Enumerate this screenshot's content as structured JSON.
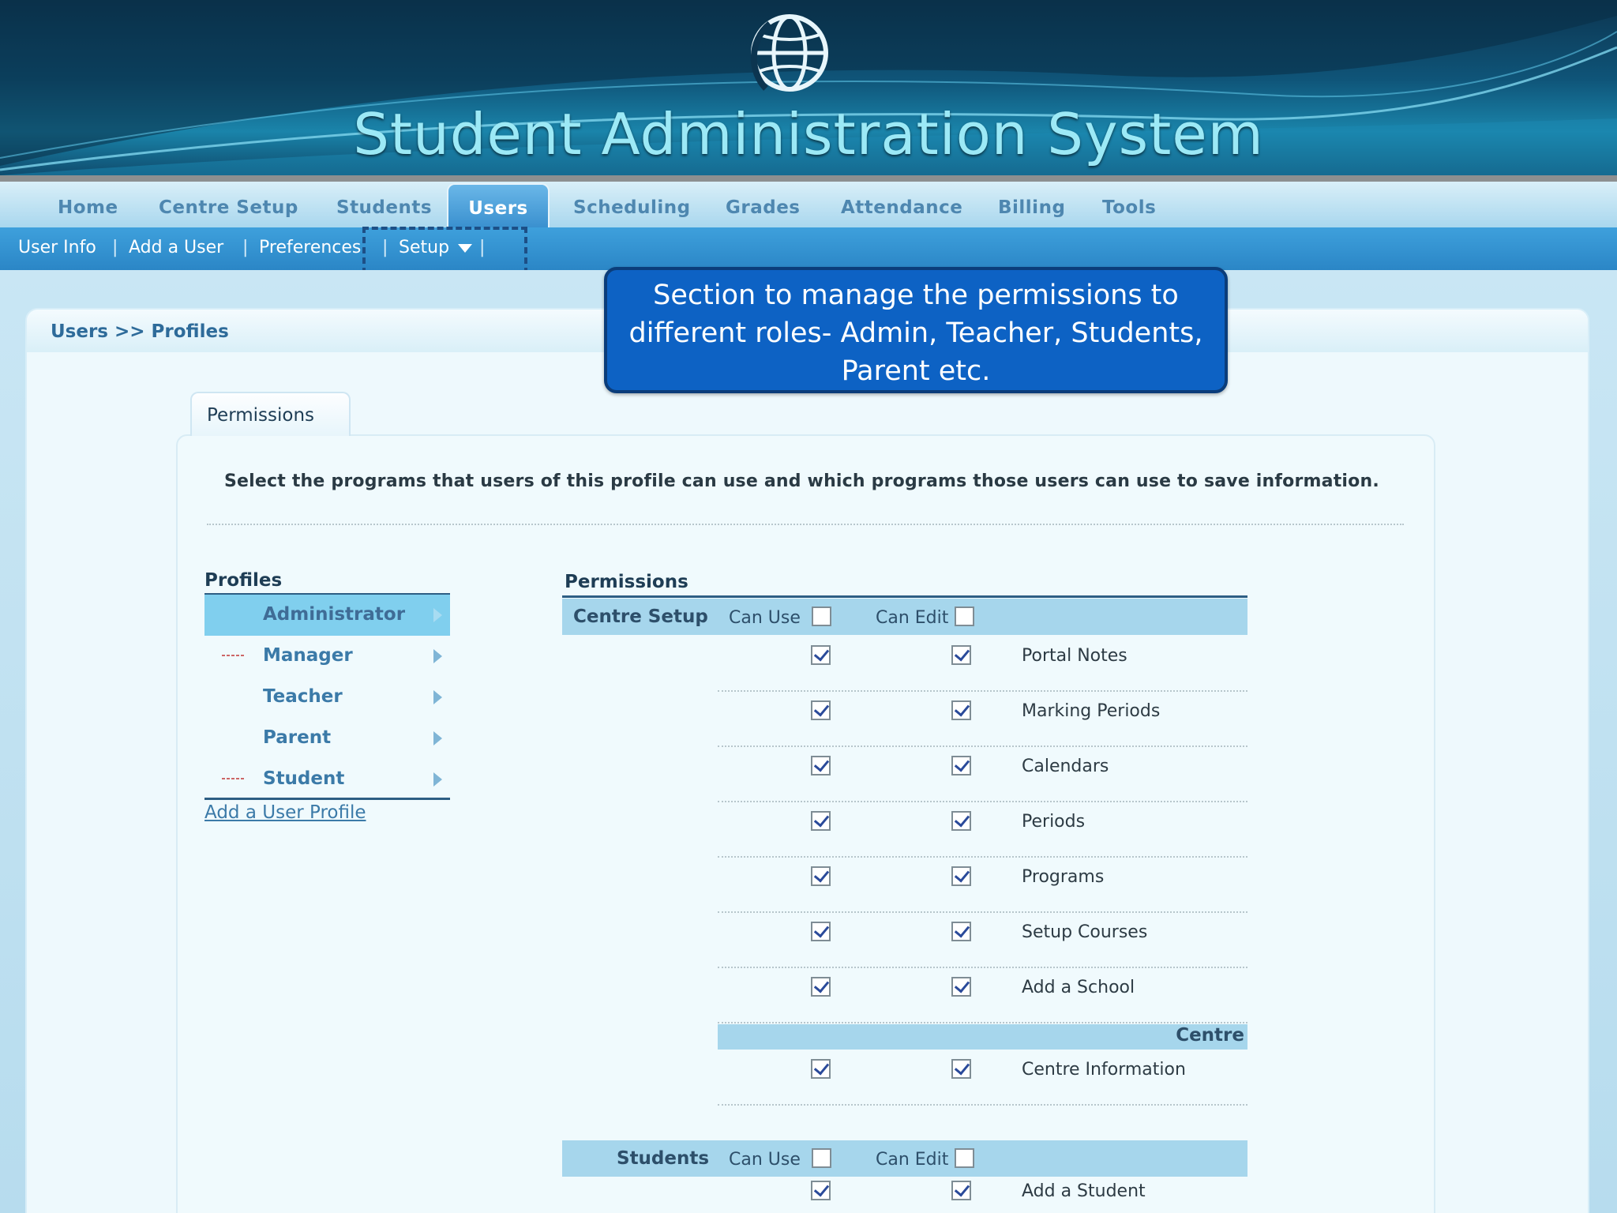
{
  "app": {
    "title": "Student Administration System"
  },
  "main_nav": [
    {
      "label": "Home"
    },
    {
      "label": "Centre Setup"
    },
    {
      "label": "Students"
    },
    {
      "label": "Users",
      "active": true
    },
    {
      "label": "Scheduling"
    },
    {
      "label": "Grades"
    },
    {
      "label": "Attendance"
    },
    {
      "label": "Billing"
    },
    {
      "label": "Tools"
    }
  ],
  "sub_nav": {
    "items": [
      "User Info",
      "Add a User",
      "Preferences",
      "Setup"
    ],
    "separator": "|"
  },
  "breadcrumb": "Users >> Profiles",
  "callout": {
    "line1": "Section to manage the permissions to",
    "line2": "different roles- Admin, Teacher, Students,",
    "line3": "Parent etc."
  },
  "permissions_tab": {
    "label": "Permissions"
  },
  "instructions": "Select the programs that users of this profile can use and which programs those users can use to save information.",
  "profiles": {
    "title": "Profiles",
    "items": [
      {
        "label": "Administrator",
        "selected": true
      },
      {
        "label": "Manager"
      },
      {
        "label": "Teacher"
      },
      {
        "label": "Parent"
      },
      {
        "label": "Student"
      }
    ],
    "add_link": "Add a User Profile"
  },
  "permissions": {
    "title": "Permissions",
    "can_use_label": "Can Use",
    "can_edit_label": "Can Edit",
    "sections": [
      {
        "name": "Centre Setup",
        "rows": [
          {
            "label": "Portal Notes",
            "can_use": true,
            "can_edit": true
          },
          {
            "label": "Marking Periods",
            "can_use": true,
            "can_edit": true
          },
          {
            "label": "Calendars",
            "can_use": true,
            "can_edit": true
          },
          {
            "label": "Periods",
            "can_use": true,
            "can_edit": true
          },
          {
            "label": "Programs",
            "can_use": true,
            "can_edit": true
          },
          {
            "label": "Setup Courses",
            "can_use": true,
            "can_edit": true
          },
          {
            "label": "Add a School",
            "can_use": true,
            "can_edit": true
          }
        ],
        "subsection": {
          "name": "Centre",
          "rows": [
            {
              "label": "Centre Information",
              "can_use": true,
              "can_edit": true
            }
          ]
        }
      },
      {
        "name": "Students",
        "rows": [
          {
            "label": "Add a Student",
            "can_use": true,
            "can_edit": true
          }
        ]
      }
    ]
  },
  "colors": {
    "accent": "#2b86c6",
    "callout": "#0d62c4",
    "section_bar": "#a6d6ec"
  }
}
